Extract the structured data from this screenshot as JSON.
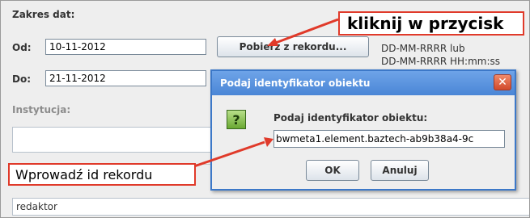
{
  "form": {
    "date_range_label": "Zakres dat:",
    "from_label": "Od:",
    "from_value": "10-11-2012",
    "to_label": "Do:",
    "to_value": "21-11-2012",
    "fetch_button": "Pobierz z rekordu...",
    "format_hint_line1": "DD-MM-RRRR lub",
    "format_hint_line2": "DD-MM-RRRR HH:mm:ss",
    "institution_label": "Instytucja:",
    "editor_value": "redaktor"
  },
  "dialog": {
    "title": "Podaj identyfikator obiektu",
    "close_glyph": "✕",
    "prompt": "Podaj identyfikator obiektu:",
    "input_value": "bwmeta1.element.baztech-ab9b38a4-9c",
    "question_glyph": "?",
    "ok_label": "OK",
    "cancel_label": "Anuluj"
  },
  "callouts": {
    "top": "kliknij w przycisk",
    "bottom": "Wprowadź id rekordu"
  },
  "colors": {
    "callout_border": "#e03a2a",
    "dialog_title_bar": "#4a86d6",
    "question_icon": "#6aa832"
  }
}
